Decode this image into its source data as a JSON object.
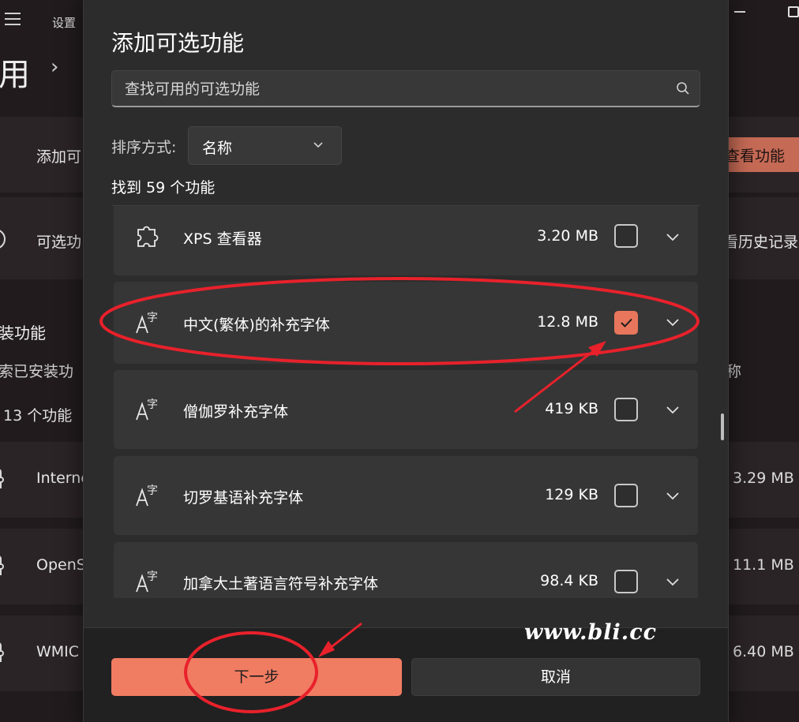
{
  "background": {
    "app_title": "设置",
    "breadcrumb_fragment": "用",
    "add_row_label": "添加可",
    "view_features_button": "查看功能",
    "history_row_label": "可选功",
    "history_link": "看历史记录",
    "installed_title": "装功能",
    "installed_search": "索已安装功",
    "installed_sort": "称",
    "installed_count": "13 个功能",
    "installed_items": [
      {
        "name": "Interne",
        "size": "3.29 MB"
      },
      {
        "name": "OpenS",
        "size": "11.1 MB"
      },
      {
        "name": "WMIC",
        "size": "6.40 MB"
      }
    ]
  },
  "dialog": {
    "title": "添加可选功能",
    "search_placeholder": "查找可用的可选功能",
    "sort_label": "排序方式:",
    "sort_value": "名称",
    "found_text": "找到 59 个功能",
    "features": [
      {
        "name": "XPS 查看器",
        "size": "3.20 MB",
        "checked": false,
        "icon": "puzzle-icon"
      },
      {
        "name": "中文(繁体)的补充字体",
        "size": "12.8 MB",
        "checked": true,
        "icon": "font-icon"
      },
      {
        "name": "僧伽罗补充字体",
        "size": "419 KB",
        "checked": false,
        "icon": "font-icon"
      },
      {
        "name": "切罗基语补充字体",
        "size": "129 KB",
        "checked": false,
        "icon": "font-icon"
      },
      {
        "name": "加拿大土著语言符号补充字体",
        "size": "98.4 KB",
        "checked": false,
        "icon": "font-icon"
      }
    ],
    "next_button": "下一步",
    "cancel_button": "取消"
  },
  "watermark": "www.bli.cc",
  "colors": {
    "accent": "#f07c62",
    "annotation_red": "#e8212b",
    "dialog_bg": "#2c2c2c",
    "card_bg": "#363636"
  }
}
